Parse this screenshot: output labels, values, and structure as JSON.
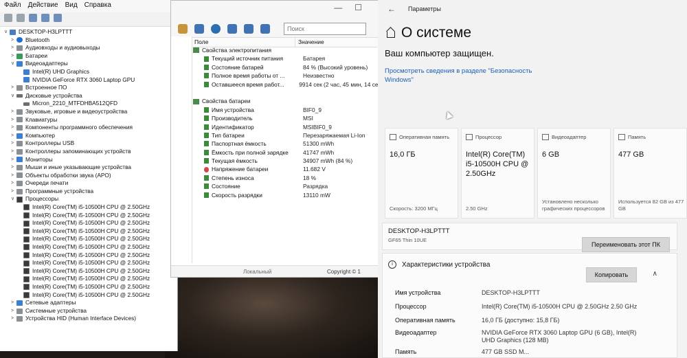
{
  "device_manager": {
    "menu": [
      "Файл",
      "Действие",
      "Вид",
      "Справка"
    ],
    "tree": [
      {
        "label": "DESKTOP-H3LPTTT",
        "indent": 0,
        "arrow": "∨",
        "icon": "computer"
      },
      {
        "label": "Bluetooth",
        "indent": 1,
        "arrow": ">",
        "icon": "bt"
      },
      {
        "label": "Аудиовходы и аудиовыходы",
        "indent": 1,
        "arrow": ">",
        "icon": "gray"
      },
      {
        "label": "Батареи",
        "indent": 1,
        "arrow": ">",
        "icon": "green"
      },
      {
        "label": "Видеоадаптеры",
        "indent": 1,
        "arrow": "∨",
        "icon": "mon"
      },
      {
        "label": "Intel(R) UHD Graphics",
        "indent": 2,
        "arrow": "",
        "icon": "mon"
      },
      {
        "label": "NVIDIA GeForce RTX 3060 Laptop GPU",
        "indent": 2,
        "arrow": "",
        "icon": "mon"
      },
      {
        "label": "Встроенное ПО",
        "indent": 1,
        "arrow": ">",
        "icon": "gray"
      },
      {
        "label": "Дисковые устройства",
        "indent": 1,
        "arrow": "∨",
        "icon": "drv"
      },
      {
        "label": "Micron_2210_MTFDHBA512QFD",
        "indent": 2,
        "arrow": "",
        "icon": "drv"
      },
      {
        "label": "Звуковые, игровые и видеоустройства",
        "indent": 1,
        "arrow": ">",
        "icon": "gray"
      },
      {
        "label": "Клавиатуры",
        "indent": 1,
        "arrow": ">",
        "icon": "gray"
      },
      {
        "label": "Компоненты программного обеспечения",
        "indent": 1,
        "arrow": ">",
        "icon": "gray"
      },
      {
        "label": "Компьютер",
        "indent": 1,
        "arrow": ">",
        "icon": "mon"
      },
      {
        "label": "Контроллеры USB",
        "indent": 1,
        "arrow": ">",
        "icon": "gray"
      },
      {
        "label": "Контроллеры запоминающих устройств",
        "indent": 1,
        "arrow": ">",
        "icon": "gray"
      },
      {
        "label": "Мониторы",
        "indent": 1,
        "arrow": ">",
        "icon": "mon"
      },
      {
        "label": "Мыши и иные указывающие устройства",
        "indent": 1,
        "arrow": ">",
        "icon": "gray"
      },
      {
        "label": "Объекты обработки звука (APO)",
        "indent": 1,
        "arrow": ">",
        "icon": "gray"
      },
      {
        "label": "Очереди печати",
        "indent": 1,
        "arrow": ">",
        "icon": "gray"
      },
      {
        "label": "Программные устройства",
        "indent": 1,
        "arrow": ">",
        "icon": "gray"
      },
      {
        "label": "Процессоры",
        "indent": 1,
        "arrow": "∨",
        "icon": "cpu"
      },
      {
        "label": "Intel(R) Core(TM) i5-10500H CPU @ 2.50GHz",
        "indent": 2,
        "arrow": "",
        "icon": "cpu"
      },
      {
        "label": "Intel(R) Core(TM) i5-10500H CPU @ 2.50GHz",
        "indent": 2,
        "arrow": "",
        "icon": "cpu"
      },
      {
        "label": "Intel(R) Core(TM) i5-10500H CPU @ 2.50GHz",
        "indent": 2,
        "arrow": "",
        "icon": "cpu"
      },
      {
        "label": "Intel(R) Core(TM) i5-10500H CPU @ 2.50GHz",
        "indent": 2,
        "arrow": "",
        "icon": "cpu"
      },
      {
        "label": "Intel(R) Core(TM) i5-10500H CPU @ 2.50GHz",
        "indent": 2,
        "arrow": "",
        "icon": "cpu"
      },
      {
        "label": "Intel(R) Core(TM) i5-10500H CPU @ 2.50GHz",
        "indent": 2,
        "arrow": "",
        "icon": "cpu"
      },
      {
        "label": "Intel(R) Core(TM) i5-10500H CPU @ 2.50GHz",
        "indent": 2,
        "arrow": "",
        "icon": "cpu"
      },
      {
        "label": "Intel(R) Core(TM) i5-10500H CPU @ 2.50GHz",
        "indent": 2,
        "arrow": "",
        "icon": "cpu"
      },
      {
        "label": "Intel(R) Core(TM) i5-10500H CPU @ 2.50GHz",
        "indent": 2,
        "arrow": "",
        "icon": "cpu"
      },
      {
        "label": "Intel(R) Core(TM) i5-10500H CPU @ 2.50GHz",
        "indent": 2,
        "arrow": "",
        "icon": "cpu"
      },
      {
        "label": "Intel(R) Core(TM) i5-10500H CPU @ 2.50GHz",
        "indent": 2,
        "arrow": "",
        "icon": "cpu"
      },
      {
        "label": "Intel(R) Core(TM) i5-10500H CPU @ 2.50GHz",
        "indent": 2,
        "arrow": "",
        "icon": "cpu"
      },
      {
        "label": "Сетевые адаптеры",
        "indent": 1,
        "arrow": ">",
        "icon": "mon"
      },
      {
        "label": "Системные устройства",
        "indent": 1,
        "arrow": ">",
        "icon": "gray"
      },
      {
        "label": "Устройства HID (Human Interface Devices)",
        "indent": 1,
        "arrow": ">",
        "icon": "gray"
      }
    ]
  },
  "props": {
    "search_placeholder": "Поиск",
    "col_field": "Поле",
    "col_value": "Значение",
    "rows": [
      {
        "k": "Свойства электропитания",
        "v": "",
        "group": true
      },
      {
        "k": "Текущий источник питания",
        "v": "Батарея"
      },
      {
        "k": "Состояние батарей",
        "v": "84 % (Высокий уровень)"
      },
      {
        "k": "Полное время работы от ...",
        "v": "Неизвестно"
      },
      {
        "k": "Оставшееся время работ...",
        "v": "9914 сек (2 час, 45 мин, 14 сек)"
      },
      {
        "k": "",
        "v": "",
        "spacer": true
      },
      {
        "k": "Свойства батареи",
        "v": "",
        "group": true
      },
      {
        "k": "Имя устройства",
        "v": "BIF0_9"
      },
      {
        "k": "Производитель",
        "v": "MSI"
      },
      {
        "k": "Идентификатор",
        "v": "MSIBIF0_9"
      },
      {
        "k": "Тип батареи",
        "v": "Перезаряжаемая Li-Ion"
      },
      {
        "k": "Паспортная ёмкость",
        "v": "51300 mWh"
      },
      {
        "k": "Ёмкость при полной зарядке",
        "v": "41747 mWh"
      },
      {
        "k": "Текущая ёмкость",
        "v": "34907 mWh  (84 %)"
      },
      {
        "k": "Напряжение батареи",
        "v": "11.682 V",
        "red": true
      },
      {
        "k": "Степень износа",
        "v": "18 %"
      },
      {
        "k": "Состояние",
        "v": "Разрядка"
      },
      {
        "k": "Скорость разрядки",
        "v": "13110 mW"
      }
    ],
    "status_left": "Локальный",
    "status_right": "Copyright © 1"
  },
  "settings": {
    "window_title": "Параметры",
    "heading": "О системе",
    "protected": "Ваш компьютер защищен.",
    "link": "Просмотреть сведения в разделе \"Безопасность Windows\"",
    "cards": [
      {
        "label": "Оперативная память",
        "value": "16,0 ГБ",
        "foot": "Скорость: 3200 МГц"
      },
      {
        "label": "Процессор",
        "value": "Intel(R) Core(TM) i5-10500H CPU @ 2.50GHz",
        "foot": "2.50 GHz"
      },
      {
        "label": "Видеоадаптер",
        "value": "6 GB",
        "foot": "Установлено несколько графических процессоров"
      },
      {
        "label": "Память",
        "value": "477 GB",
        "foot": "Используется 82 GB из 477 GB"
      }
    ],
    "device_name": "DESKTOP-H3LPTTT",
    "device_model": "GF65 Thin 10UE",
    "rename_button": "Переименовать этот ПК",
    "specs_title": "Характеристики устройства",
    "copy_button": "Копировать",
    "specs": [
      {
        "k": "Имя устройства",
        "v": "DESKTOP-H3LPTTT"
      },
      {
        "k": "Процессор",
        "v": "Intel(R) Core(TM) i5-10500H CPU @ 2.50GHz   2.50 GHz"
      },
      {
        "k": "Оперативная память",
        "v": "16,0 ГБ (доступно: 15,8 ГБ)"
      },
      {
        "k": "Видеоадаптер",
        "v": "NVIDIA GeForce RTX 3060 Laptop GPU (6 GB), Intel(R) UHD Graphics (128 MB)"
      },
      {
        "k": "Память",
        "v": "477 GB SSD M..."
      }
    ]
  }
}
